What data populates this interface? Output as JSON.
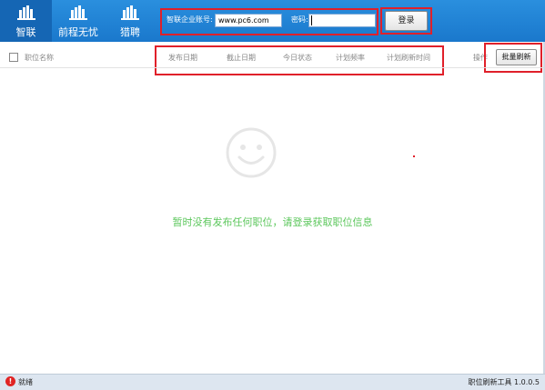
{
  "site_tabs": [
    {
      "label": "智联",
      "active": true
    },
    {
      "label": "前程无忧",
      "active": false
    },
    {
      "label": "猎聘",
      "active": false
    }
  ],
  "login": {
    "account_label": "智联企业账号:",
    "account_value": "www.pc6.com",
    "password_label": "密码:",
    "password_value": "",
    "login_button": "登录"
  },
  "table": {
    "select_all_checked": false,
    "columns": [
      "职位名称",
      "发布日期",
      "截止日期",
      "今日状态",
      "计划频率",
      "计划刷新时间",
      "操作"
    ],
    "batch_refresh_button": "批量刷新"
  },
  "empty_state": {
    "icon": "smiley-icon",
    "message": "暂时没有发布任何职位，请登录获取职位信息"
  },
  "status_bar": {
    "icon": "warning-icon",
    "status": "就绪",
    "version": "职位刷新工具 1.0.0.5"
  },
  "colors": {
    "topbar": "#1a78cc",
    "active_tab": "#1566b4",
    "highlight": "#e0202a",
    "empty_message": "#5cc75c",
    "status_bar": "#dde6f0"
  }
}
